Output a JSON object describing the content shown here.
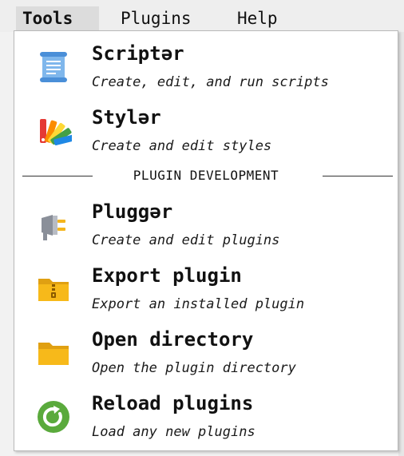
{
  "menubar": {
    "items": [
      {
        "label": "Tools"
      },
      {
        "label": "Plugins"
      },
      {
        "label": "Help"
      }
    ]
  },
  "dropdown": {
    "entries": [
      {
        "title": "Scriptər",
        "desc": "Create, edit, and run scripts",
        "icon": "scroll-icon"
      },
      {
        "title": "Stylər",
        "desc": "Create and edit styles",
        "icon": "color-palette-icon"
      },
      {
        "title": "Pluggər",
        "desc": "Create and edit plugins",
        "icon": "plug-icon"
      },
      {
        "title": "Export plugin",
        "desc": "Export an installed plugin",
        "icon": "zip-folder-icon"
      },
      {
        "title": "Open directory",
        "desc": "Open the plugin directory",
        "icon": "folder-icon"
      },
      {
        "title": "Reload plugins",
        "desc": "Load any new plugins",
        "icon": "reload-icon"
      }
    ],
    "separator_label": "PLUGIN DEVELOPMENT"
  },
  "colors": {
    "menu_active": "#dcdcdc",
    "folder": "#f7b91a",
    "reload": "#5aaa3c",
    "scroll": "#4a8fd8"
  }
}
